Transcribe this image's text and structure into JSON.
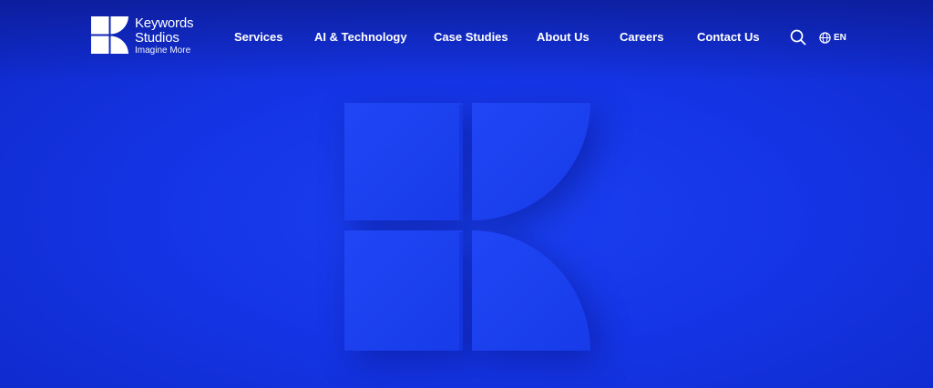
{
  "brand": {
    "name_line1": "Keywords",
    "name_line2": "Studios",
    "tagline": "Imagine More",
    "logo_icon": "keywords-k-logo-icon"
  },
  "nav": {
    "items": [
      {
        "label": "Services"
      },
      {
        "label": "AI & Technology"
      },
      {
        "label": "Case Studies"
      },
      {
        "label": "About Us"
      },
      {
        "label": "Careers"
      },
      {
        "label": "Contact Us"
      }
    ],
    "search_icon": "search-icon",
    "language_icon": "globe-icon",
    "language_label": "EN"
  },
  "hero": {
    "image": "k-logo-3d-render"
  },
  "colors": {
    "background": "#1535e6",
    "hero_mark": "#1a3ef2",
    "text": "#ffffff"
  }
}
